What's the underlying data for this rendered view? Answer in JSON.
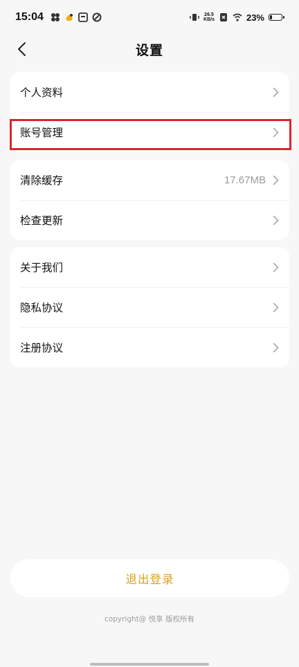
{
  "status_bar": {
    "time": "15:04",
    "net_speed_value": "26.5",
    "net_speed_unit": "KB/s",
    "battery_percent": "23%",
    "battery_level": 0.23
  },
  "header": {
    "title": "设置"
  },
  "groups": [
    [
      {
        "label": "个人资料",
        "value": ""
      },
      {
        "label": "账号管理",
        "value": ""
      }
    ],
    [
      {
        "label": "清除缓存",
        "value": "17.67MB"
      },
      {
        "label": "检查更新",
        "value": ""
      }
    ],
    [
      {
        "label": "关于我们",
        "value": ""
      },
      {
        "label": "隐私协议",
        "value": ""
      },
      {
        "label": "注册协议",
        "value": ""
      }
    ]
  ],
  "footer": {
    "logout_label": "退出登录",
    "copyright": "copyright@ 悦享 版权所有"
  },
  "colors": {
    "accent": "#d9a21e",
    "highlight": "#d9252c"
  }
}
